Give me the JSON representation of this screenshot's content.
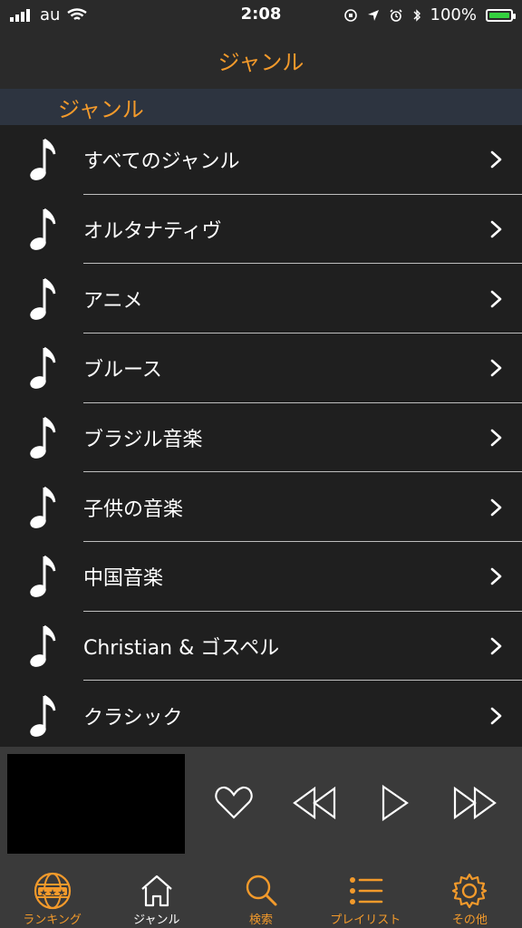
{
  "status": {
    "carrier": "au",
    "time": "2:08",
    "battery_percent": "100%"
  },
  "nav": {
    "title": "ジャンル"
  },
  "section": {
    "title": "ジャンル"
  },
  "genres": [
    "すべてのジャンル",
    "オルタナティヴ",
    "アニメ",
    "ブルース",
    "ブラジル音楽",
    "子供の音楽",
    "中国音楽",
    "Christian & ゴスペル",
    "クラシック"
  ],
  "tabs": [
    {
      "label": "ランキング",
      "icon": "ranking-globe-icon",
      "color": "#f39a2b"
    },
    {
      "label": "ジャンル",
      "icon": "home-icon",
      "color": "#ffffff"
    },
    {
      "label": "検索",
      "icon": "search-icon",
      "color": "#f39a2b"
    },
    {
      "label": "プレイリスト",
      "icon": "list-icon",
      "color": "#f39a2b"
    },
    {
      "label": "その他",
      "icon": "gear-icon",
      "color": "#f39a2b"
    }
  ],
  "colors": {
    "accent": "#f39a2b",
    "section_bg": "#2d3440",
    "list_bg": "#1f1f1f",
    "player_bg": "#3a3a3a"
  }
}
